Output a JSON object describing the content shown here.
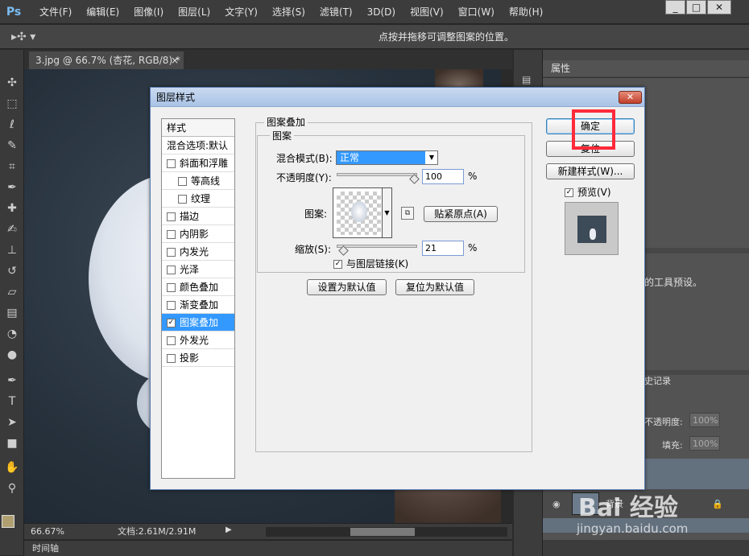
{
  "app": {
    "logo": "Ps"
  },
  "menu": [
    "文件(F)",
    "编辑(E)",
    "图像(I)",
    "图层(L)",
    "文字(Y)",
    "选择(S)",
    "滤镜(T)",
    "3D(D)",
    "视图(V)",
    "窗口(W)",
    "帮助(H)"
  ],
  "window_controls": {
    "minimize": "_",
    "maximize": "□",
    "close": "✕"
  },
  "options_bar": {
    "hint": "点按并拖移可调整图案的位置。"
  },
  "document": {
    "tab_title": "3.jpg @ 66.7% (杏花, RGB/8) *",
    "tab_close": "×"
  },
  "status": {
    "zoom": "66.67%",
    "doc_info": "文档:2.61M/2.91M"
  },
  "timeline": {
    "label": "时间轴"
  },
  "right_panels": {
    "properties_title": "属性",
    "tool_preset_fragment": "的工具预设。",
    "history_fragment": "史记录",
    "opacity_label": "不透明度:",
    "opacity_value": "100%",
    "fill_label": "填充:",
    "fill_value": "100%",
    "layer_name_fragment": "背景"
  },
  "dialog": {
    "title": "图层样式",
    "close": "✕",
    "style_list": {
      "header": "样式",
      "blend_options": "混合选项:默认",
      "items": [
        {
          "label": "斜面和浮雕",
          "checked": false,
          "indent": false,
          "selected": false
        },
        {
          "label": "等高线",
          "checked": false,
          "indent": true,
          "selected": false
        },
        {
          "label": "纹理",
          "checked": false,
          "indent": true,
          "selected": false
        },
        {
          "label": "描边",
          "checked": false,
          "indent": false,
          "selected": false
        },
        {
          "label": "内阴影",
          "checked": false,
          "indent": false,
          "selected": false
        },
        {
          "label": "内发光",
          "checked": false,
          "indent": false,
          "selected": false
        },
        {
          "label": "光泽",
          "checked": false,
          "indent": false,
          "selected": false
        },
        {
          "label": "颜色叠加",
          "checked": false,
          "indent": false,
          "selected": false
        },
        {
          "label": "渐变叠加",
          "checked": false,
          "indent": false,
          "selected": false
        },
        {
          "label": "图案叠加",
          "checked": true,
          "indent": false,
          "selected": true
        },
        {
          "label": "外发光",
          "checked": false,
          "indent": false,
          "selected": false
        },
        {
          "label": "投影",
          "checked": false,
          "indent": false,
          "selected": false
        }
      ]
    },
    "pattern_overlay": {
      "group_title": "图案叠加",
      "sub_title": "图案",
      "blend_mode_label": "混合模式(B):",
      "blend_mode_value": "正常",
      "opacity_label": "不透明度(Y):",
      "opacity_value": "100",
      "opacity_unit": "%",
      "opacity_level": 1.0,
      "pattern_label": "图案:",
      "snap_origin_button": "贴紧原点(A)",
      "scale_label": "缩放(S):",
      "scale_value": "21",
      "scale_unit": "%",
      "scale_level": 0.21,
      "link_with_layer_label": "与图层链接(K)",
      "link_with_layer_checked": true,
      "set_default_button": "设置为默认值",
      "reset_default_button": "复位为默认值"
    },
    "buttons": {
      "ok": "确定",
      "reset": "复位",
      "new_style": "新建样式(W)...",
      "preview_label": "预览(V)",
      "preview_checked": true
    }
  },
  "watermark": {
    "brand": "Bai 经验",
    "url": "jingyan.baidu.com"
  },
  "colors": {
    "highlight": "#ff2a3a",
    "selection": "#3399ff",
    "accent": "#7bbcf2"
  }
}
